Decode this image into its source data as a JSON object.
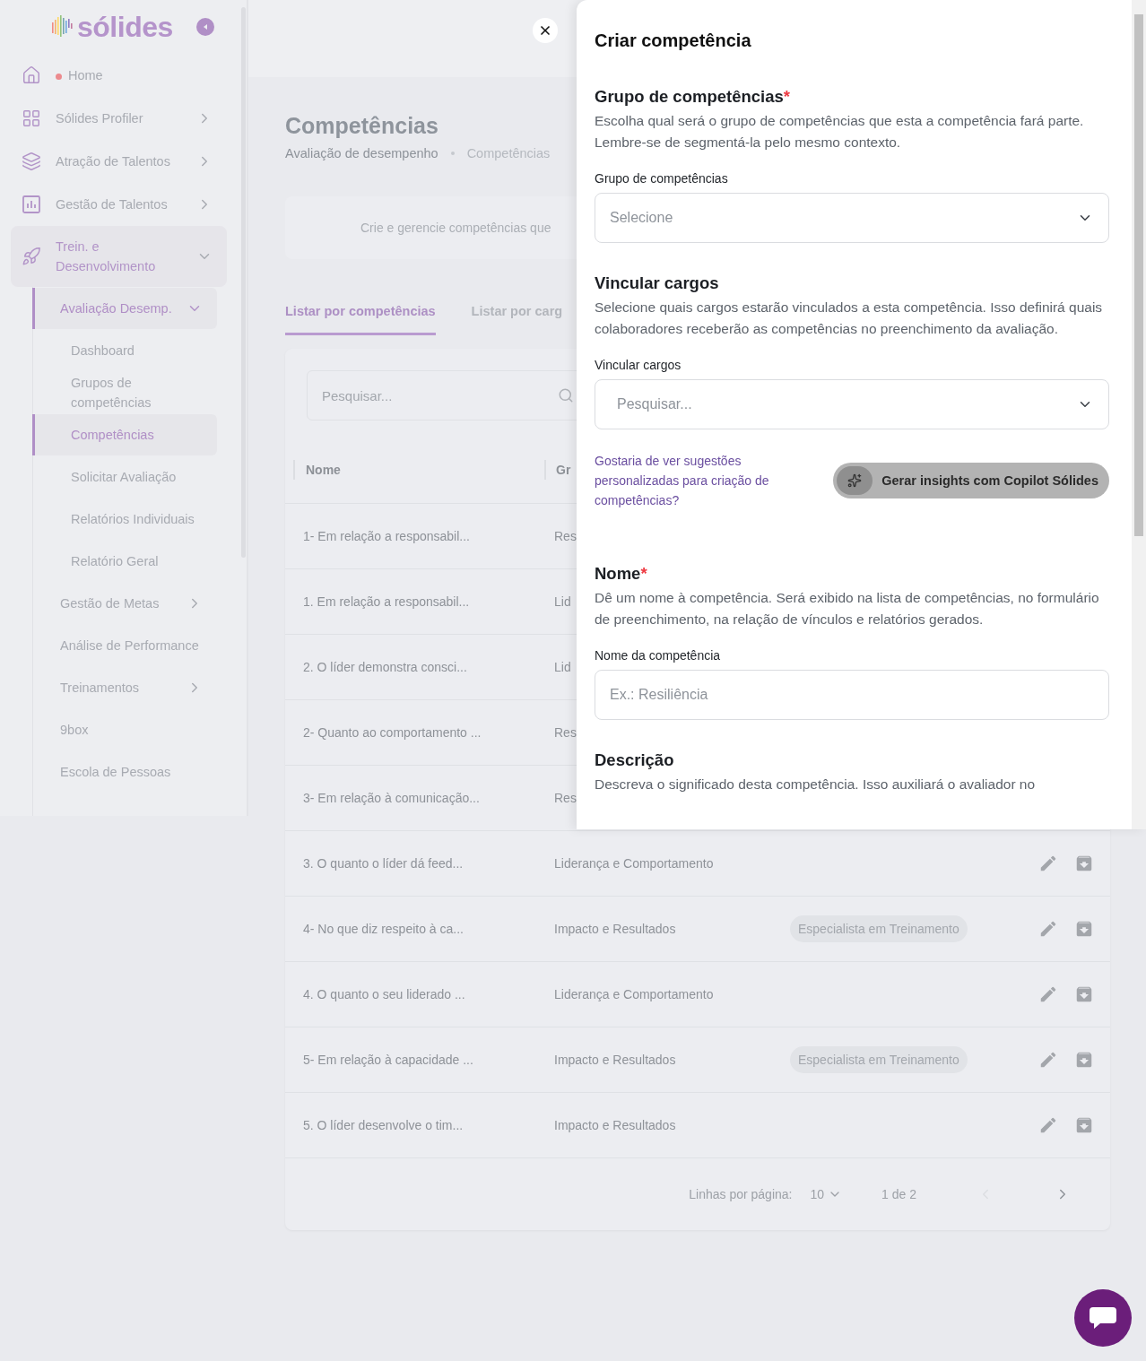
{
  "logo": {
    "text": "sólides"
  },
  "sidebar": {
    "items": [
      {
        "label": "Home",
        "dot": true
      },
      {
        "label": "Sólides Profiler",
        "expanded": false
      },
      {
        "label": "Atração de Talentos",
        "expanded": false
      },
      {
        "label": "Gestão de Talentos",
        "expanded": false
      },
      {
        "label": "Trein. e Desenvolvimento",
        "expanded": true,
        "children": [
          {
            "label": "Avaliação Desemp.",
            "expanded": true,
            "children": [
              {
                "label": "Dashboard",
                "selected": false
              },
              {
                "label": "Grupos de competências",
                "selected": false
              },
              {
                "label": "Competências",
                "selected": true
              },
              {
                "label": "Solicitar Avaliação",
                "selected": false
              },
              {
                "label": "Relatórios Individuais",
                "selected": false
              },
              {
                "label": "Relatório Geral",
                "selected": false
              }
            ]
          },
          {
            "label": "Gestão de Metas",
            "expanded": false,
            "selected": false
          },
          {
            "label": "Análise de Performance",
            "selected": false
          },
          {
            "label": "Treinamentos",
            "expanded": false,
            "selected": false
          },
          {
            "label": "9box",
            "selected": false
          },
          {
            "label": "Escola de Pessoas",
            "selected": false
          }
        ]
      }
    ]
  },
  "page": {
    "title": "Competências",
    "breadcrumb": [
      "Avaliação de desempenho",
      "Competências"
    ],
    "info": "Crie e gerencie competências que",
    "tabs": [
      {
        "label": "Listar por competências",
        "selected": true
      },
      {
        "label": "Listar por carg",
        "selected": false
      }
    ],
    "search": {
      "placeholder": "Pesquisar..."
    }
  },
  "table": {
    "columns": [
      "Nome",
      "Gr"
    ],
    "rows": [
      {
        "name": "1- Em relação a responsabil...",
        "group": "Res"
      },
      {
        "name": "1. Em relação a responsabil...",
        "group": "Lid"
      },
      {
        "name": "2. O líder demonstra consci...",
        "group": "Lid"
      },
      {
        "name": "2- Quanto ao comportamento ...",
        "group": "Res"
      },
      {
        "name": "3- Em relação à comunicação...",
        "group": "Res"
      },
      {
        "name": "3. O quanto o líder dá feed...",
        "group": "Liderança e Comportamento"
      },
      {
        "name": "4- No que diz respeito à ca...",
        "group": "Impacto e Resultados",
        "tag": "Especialista em Treinamento"
      },
      {
        "name": "4. O quanto o seu liderado ...",
        "group": "Liderança e Comportamento"
      },
      {
        "name": "5- Em relação à capacidade ...",
        "group": "Impacto e Resultados",
        "tag": "Especialista em Treinamento"
      },
      {
        "name": "5. O líder desenvolve o tim...",
        "group": "Impacto e Resultados"
      }
    ]
  },
  "pagination": {
    "label": "Linhas por página:",
    "page_size": "10",
    "range": "1 de 2",
    "prev_disabled": true,
    "next_disabled": false
  },
  "drawer": {
    "title": "Criar competência",
    "sections": [
      {
        "kind": "select",
        "heading": "Grupo de competências",
        "required_mark": "*",
        "description": "Escolha qual será o grupo de competências que esta a competência fará parte. Lembre-se de segmentá-la pelo mesmo contexto.",
        "field_label": "Grupo de competências",
        "placeholder": "Selecione"
      },
      {
        "kind": "select",
        "heading": "Vincular cargos",
        "description": "Selecione quais cargos estarão vinculados a esta competência. Isso definirá quais colaboradores receberão as competências no preenchimento da avaliação.",
        "field_label": "Vincular cargos",
        "placeholder": "Pesquisar..."
      },
      {
        "kind": "copilot",
        "prompt": "Gostaria de ver sugestões personalizadas para criação de competências?",
        "button": "Gerar insights com Copilot Sólides"
      },
      {
        "kind": "text",
        "heading": "Nome",
        "required_mark": "*",
        "description": "Dê um nome à competência. Será exibido na lista de competências, no formulário de preenchimento, na relação de vínculos e relatórios gerados.",
        "field_label": "Nome da competência",
        "placeholder": "Ex.: Resiliência"
      },
      {
        "kind": "heading",
        "heading": "Descrição",
        "description": "Descreva o significado desta competência. Isso auxiliará o avaliador no"
      }
    ]
  }
}
